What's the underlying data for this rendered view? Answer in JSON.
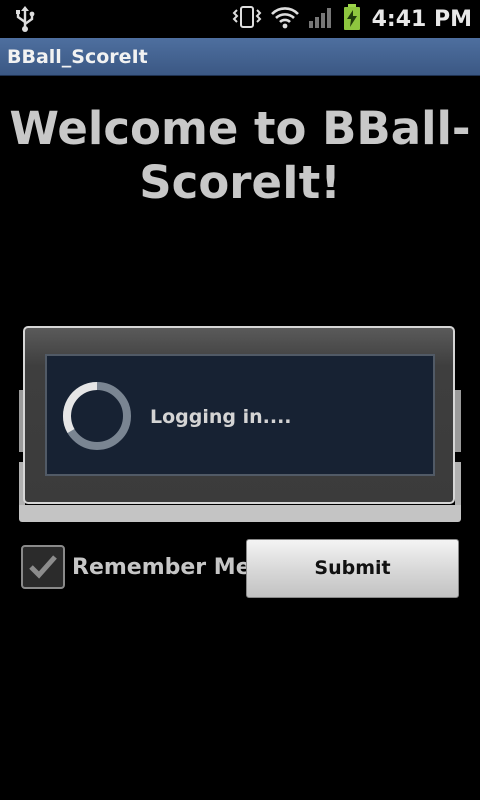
{
  "status_bar": {
    "time": "4:41 PM",
    "icons": [
      "usb-icon",
      "vibrate-icon",
      "wifi-icon",
      "signal-icon",
      "battery-charging-icon"
    ]
  },
  "app": {
    "title": "BBall_ScoreIt"
  },
  "main": {
    "welcome_text": "Welcome to BBall-ScoreIt!"
  },
  "dialog": {
    "message": "Logging in...."
  },
  "form": {
    "remember_me_label": "Remember Me",
    "remember_me_checked": true,
    "submit_label": "Submit"
  }
}
